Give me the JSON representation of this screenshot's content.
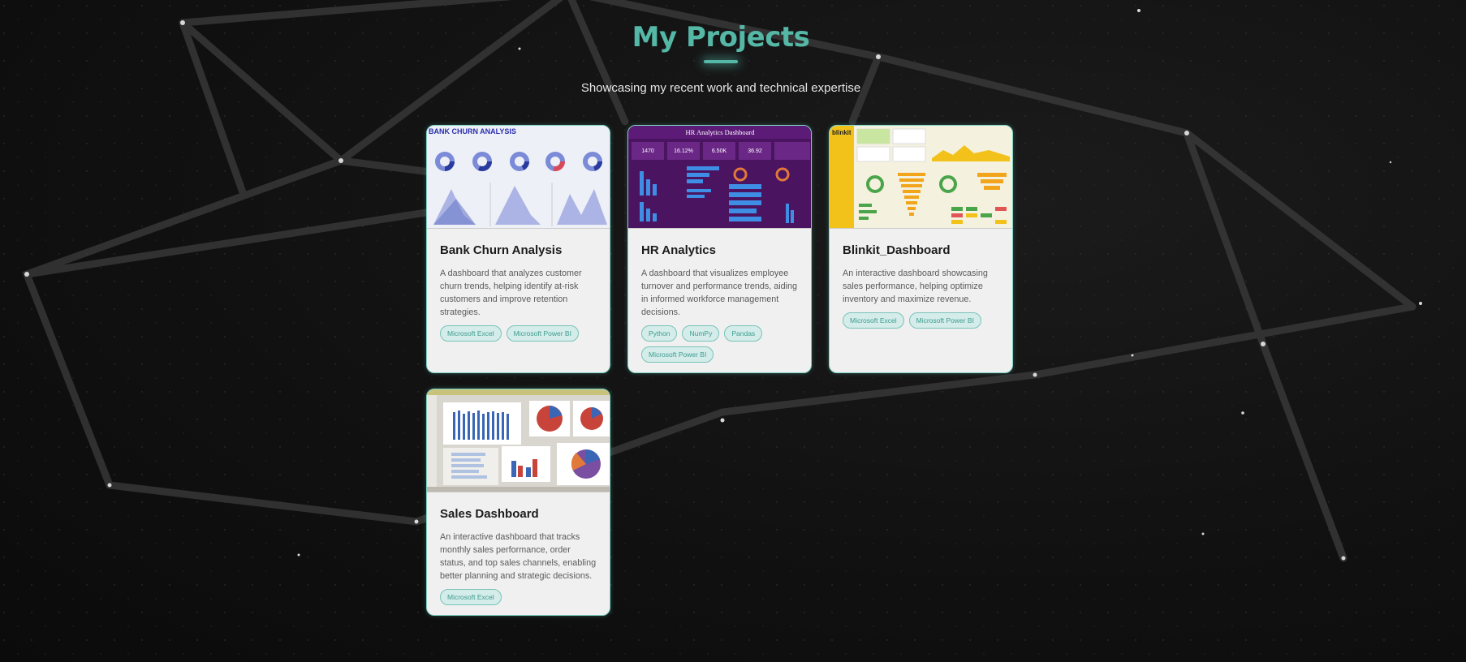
{
  "header": {
    "title": "My Projects",
    "subtitle": "Showcasing my recent work and technical expertise"
  },
  "colors": {
    "accent": "#55b7a6",
    "card_bg": "#f0f0f0",
    "page_bg": "#111111"
  },
  "projects": [
    {
      "title": "Bank Churn Analysis",
      "thumbnail_caption": "BANK CHURN ANALYSIS",
      "description": "A dashboard that analyzes customer churn trends, helping identify at-risk customers and improve retention strategies.",
      "tags": [
        "Microsoft Excel",
        "Microsoft Power BI"
      ]
    },
    {
      "title": "HR Analytics",
      "thumbnail_caption": "HR Analytics Dashboard",
      "thumbnail_kpis": [
        "1470",
        "16.12%",
        "6.50K",
        "36.92"
      ],
      "description": "A dashboard that visualizes employee turnover and performance trends, aiding in informed workforce management decisions.",
      "tags": [
        "Python",
        "NumPy",
        "Pandas",
        "Microsoft Power BI"
      ]
    },
    {
      "title": "Blinkit_Dashboard",
      "thumbnail_caption": "blinkit",
      "description": "An interactive dashboard showcasing sales performance, helping optimize inventory and maximize revenue.",
      "tags": [
        "Microsoft Excel",
        "Microsoft Power BI"
      ]
    },
    {
      "title": "Sales Dashboard",
      "description": "An interactive dashboard that tracks monthly sales performance, order status, and top sales channels, enabling better planning and strategic decisions.",
      "tags": [
        "Microsoft Excel"
      ]
    }
  ]
}
